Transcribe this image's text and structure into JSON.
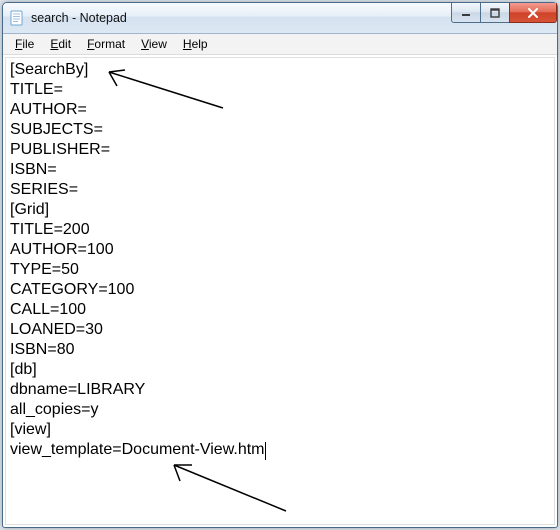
{
  "window": {
    "title": "search - Notepad"
  },
  "menu": {
    "file": "File",
    "edit": "Edit",
    "format": "Format",
    "view": "View",
    "help": "Help"
  },
  "document": {
    "lines": [
      "[SearchBy]",
      "TITLE=",
      "AUTHOR=",
      "SUBJECTS=",
      "PUBLISHER=",
      "ISBN=",
      "SERIES=",
      "[Grid]",
      "TITLE=200",
      "AUTHOR=100",
      "TYPE=50",
      "CATEGORY=100",
      "CALL=100",
      "LOANED=30",
      "ISBN=80",
      "[db]",
      "dbname=LIBRARY",
      "all_copies=y",
      "[view]",
      "view_template=Document-View.htm"
    ],
    "text": "[SearchBy]\nTITLE=\nAUTHOR=\nSUBJECTS=\nPUBLISHER=\nISBN=\nSERIES=\n[Grid]\nTITLE=200\nAUTHOR=100\nTYPE=50\nCATEGORY=100\nCALL=100\nLOANED=30\nISBN=80\n[db]\ndbname=LIBRARY\nall_copies=y\n[view]\nview_template=Document-View.htm"
  },
  "icons": {
    "minimize": "minimize",
    "maximize": "maximize",
    "close": "close",
    "app": "notepad"
  },
  "colors": {
    "close_button": "#cf4327",
    "titlebar_top": "#e6eef7",
    "border": "#4a6a8a"
  }
}
